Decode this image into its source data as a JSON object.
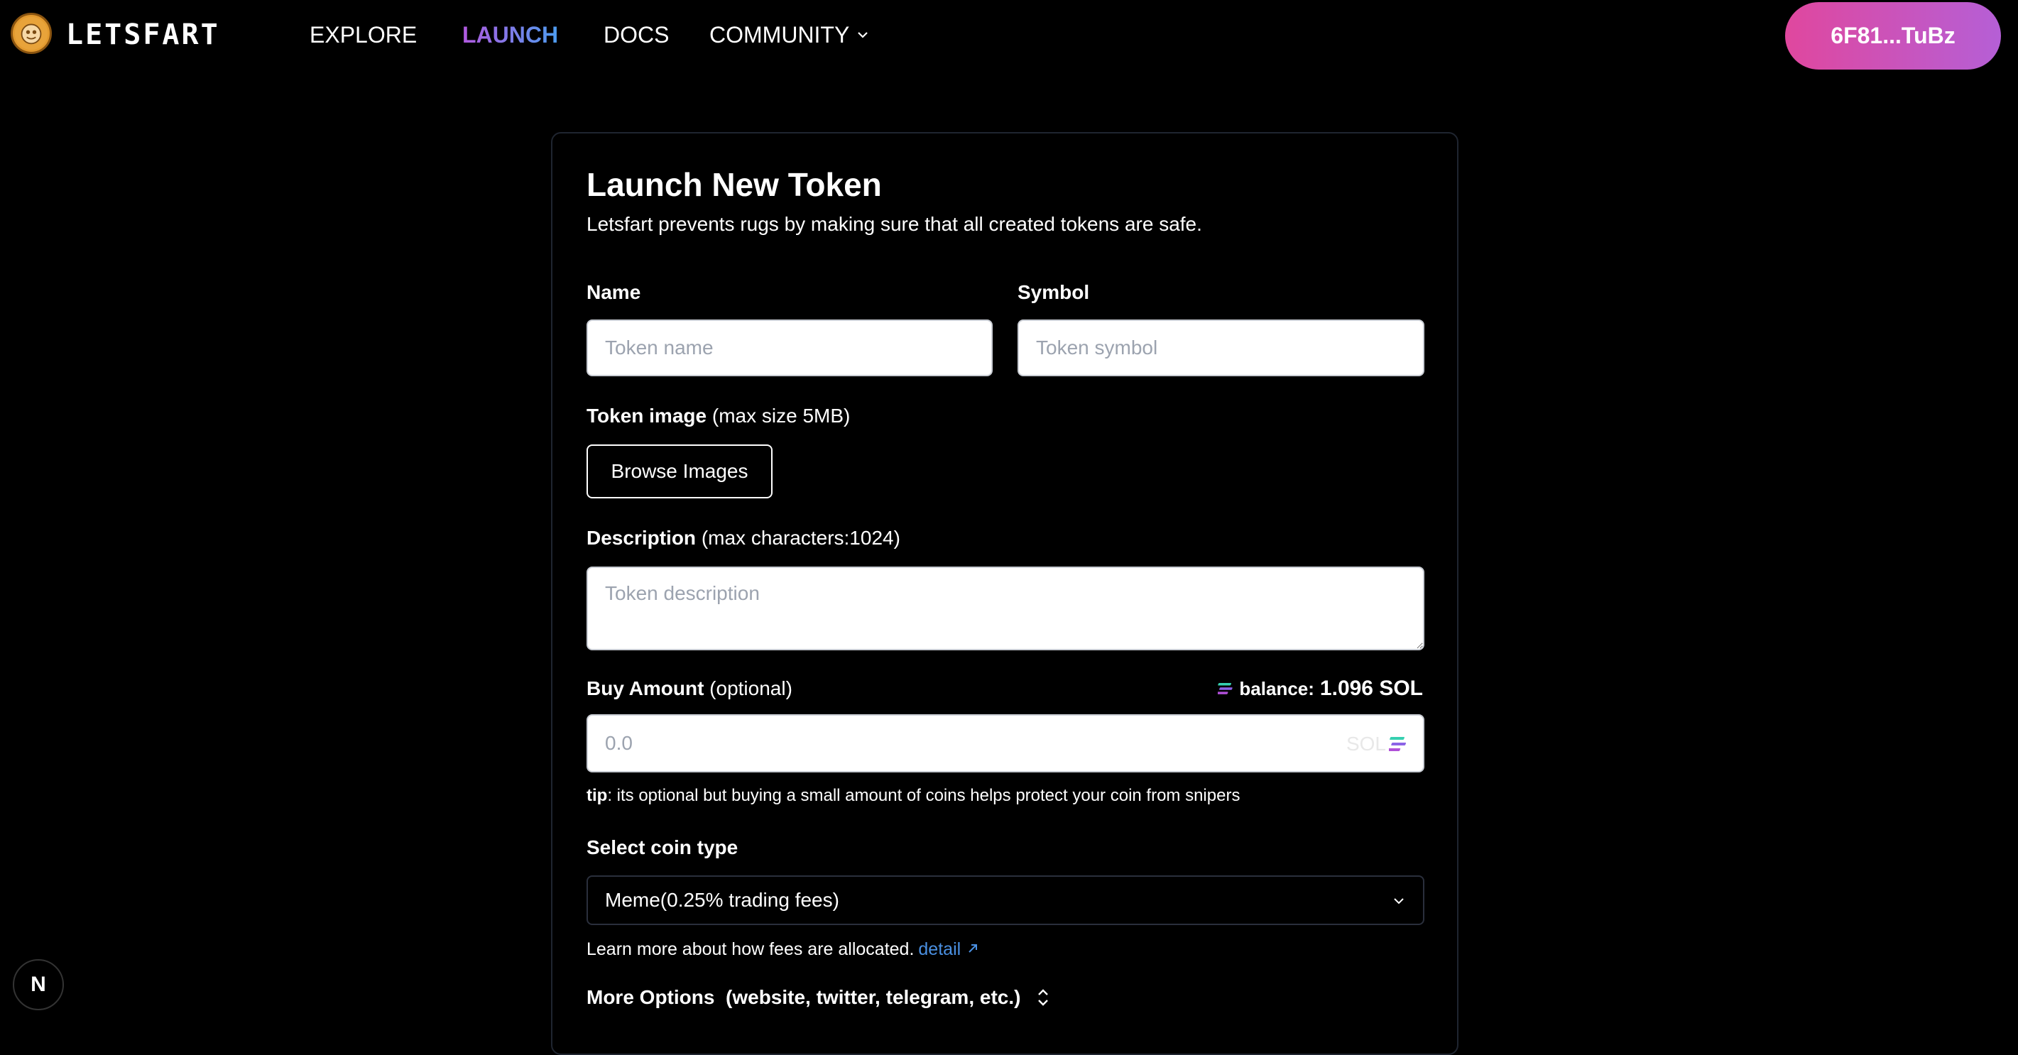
{
  "header": {
    "brand": "LETSFART",
    "nav": [
      {
        "label": "EXPLORE"
      },
      {
        "label": "LAUNCH"
      },
      {
        "label": "DOCS"
      },
      {
        "label": "COMMUNITY"
      }
    ],
    "wallet": "6F81...TuBz"
  },
  "form": {
    "title": "Launch New Token",
    "subtitle": "Letsfart prevents rugs by making sure that all created tokens are safe.",
    "name_label": "Name",
    "name_placeholder": "Token name",
    "symbol_label": "Symbol",
    "symbol_placeholder": "Token symbol",
    "image_label": "Token image",
    "image_note": "(max size 5MB)",
    "browse_button": "Browse Images",
    "description_label": "Description",
    "description_note": "(max characters:1024)",
    "description_placeholder": "Token description",
    "buy_label": "Buy Amount",
    "buy_note": "(optional)",
    "balance_label": "balance:",
    "balance_value": "1.096 SOL",
    "buy_placeholder": "0.0",
    "buy_suffix": "SOL",
    "tip_bold": "tip",
    "tip_text": ": its optional but buying a small amount of coins helps protect your coin from snipers",
    "coin_type_label": "Select coin type",
    "coin_type_selected": "Meme(0.25% trading fees)",
    "learn_text": "Learn more about how fees are allocated.",
    "learn_link": "detail",
    "more_options_label": "More Options",
    "more_options_note": "(website, twitter, telegram, etc.)"
  },
  "badge": "N",
  "colors": {
    "background": "#000000",
    "accent_gradient_start": "#e0479e",
    "accent_gradient_end": "#b55fd6",
    "launch_gradient_start": "#b259e0",
    "launch_gradient_end": "#4d9df0",
    "link": "#4a90e2"
  },
  "icons": [
    "logo-icon",
    "chevron-down-icon",
    "solana-icon",
    "sort-updown-icon",
    "next-badge-icon",
    "external-arrow-icon"
  ]
}
